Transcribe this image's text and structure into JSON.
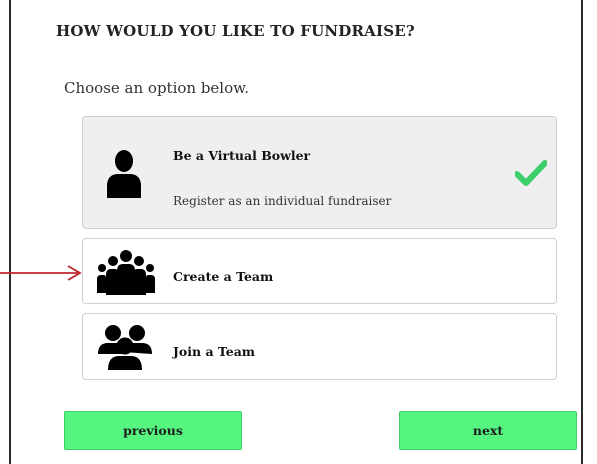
{
  "header": {
    "title": "HOW WOULD YOU LIKE TO FUNDRAISE?"
  },
  "prompt": "Choose an option below.",
  "options": [
    {
      "title": "Be a Virtual Bowler",
      "description": "Register as an individual fundraiser",
      "icon": "person-icon",
      "selected": true
    },
    {
      "title": "Create a Team",
      "description": "",
      "icon": "group-icon",
      "selected": false
    },
    {
      "title": "Join a Team",
      "description": "",
      "icon": "people-icon",
      "selected": false
    }
  ],
  "buttons": {
    "previous": "previous",
    "next": "next"
  },
  "colors": {
    "accent": "#55f57f",
    "check": "#3ccf6c",
    "arrow": "#c0262c"
  }
}
